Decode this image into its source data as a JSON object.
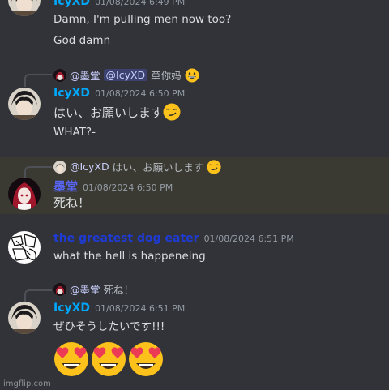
{
  "colors": {
    "icy_name": "#00a8fc",
    "mo_name": "#5865f2",
    "eater_name": "#1f3bd6",
    "background": "#313338",
    "highlight": "#3a3a32"
  },
  "messages": {
    "m1": {
      "username": "IcyXD",
      "timestamp": "01/08/2024 6:49 PM",
      "lines": [
        "Damn, I'm pulling men now too?",
        "God damn"
      ]
    },
    "m2": {
      "reply_mention": "@墨堂",
      "reply_pill": "@IcyXD",
      "reply_text": "草你妈",
      "reply_emoji": "grinning-face-emoji",
      "username": "IcyXD",
      "timestamp": "01/08/2024 6:50 PM",
      "line1": "はい、お願いします",
      "line1_emoji": "smirking-face-emoji",
      "line2": "WHAT?-"
    },
    "m3": {
      "reply_mention": "@IcyXD",
      "reply_text": "はい、お願いします",
      "reply_emoji": "smirking-face-emoji",
      "username": "墨堂",
      "timestamp": "01/08/2024 6:50 PM",
      "line1": "死ね！"
    },
    "m4": {
      "username": "the greatest dog eater",
      "timestamp": "01/08/2024 6:51 PM",
      "line1": "what the hell is happeneing"
    },
    "m5": {
      "reply_mention": "@墨堂",
      "reply_text": "死ね！",
      "username": "IcyXD",
      "timestamp": "01/08/2024 6:51 PM",
      "line1": "ぜひそうしたいです!!!",
      "big_emoji": [
        "heart-eyes-emoji",
        "heart-eyes-emoji",
        "heart-eyes-emoji"
      ]
    }
  },
  "watermark": "imgflip.com"
}
